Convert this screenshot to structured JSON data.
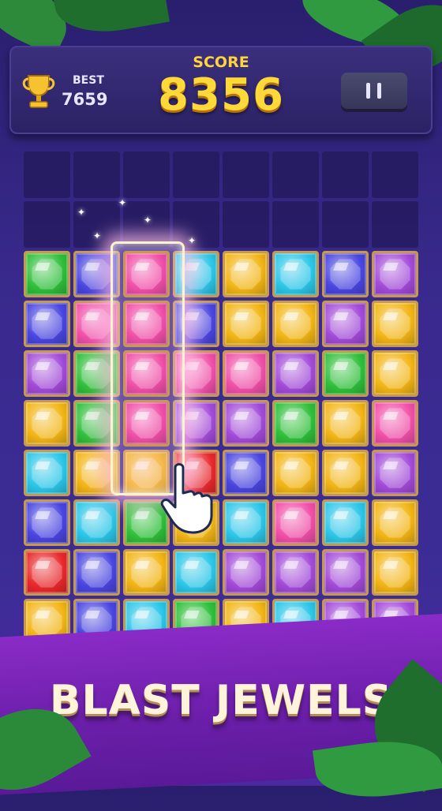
{
  "hud": {
    "best_label": "BEST",
    "best_value": "7659",
    "score_label": "SCORE",
    "score_value": "8356"
  },
  "banner": {
    "text": "BLAST JEWELS"
  },
  "colors": {
    "G": "#2fbf3a",
    "B": "#4a45e0",
    "P": "#a24ad8",
    "Y": "#f2b515",
    "C": "#2bc6e8",
    "R": "#e8282c",
    "K": "#f04fa8"
  },
  "board": {
    "columns": 8,
    "rows": 10,
    "empty_rows": 2,
    "gem_rows": [
      [
        "G",
        "B",
        "K",
        "C",
        "Y",
        "C",
        "B",
        "P"
      ],
      [
        "B",
        "K",
        "K",
        "B",
        "Y",
        "Y",
        "P",
        "Y"
      ],
      [
        "P",
        "G",
        "K",
        "K",
        "K",
        "P",
        "G",
        "Y"
      ],
      [
        "Y",
        "G",
        "K",
        "P",
        "P",
        "G",
        "Y",
        "K"
      ],
      [
        "C",
        "Y",
        "Y",
        "R",
        "B",
        "Y",
        "Y",
        "P"
      ],
      [
        "B",
        "C",
        "G",
        "Y",
        "C",
        "K",
        "C",
        "Y"
      ],
      [
        "R",
        "B",
        "Y",
        "C",
        "P",
        "P",
        "P",
        "Y"
      ],
      [
        "Y",
        "B",
        "C",
        "G",
        "Y",
        "C",
        "P",
        "P"
      ]
    ],
    "selected_column": 2,
    "selected_rows": [
      0,
      1,
      2,
      3
    ]
  }
}
